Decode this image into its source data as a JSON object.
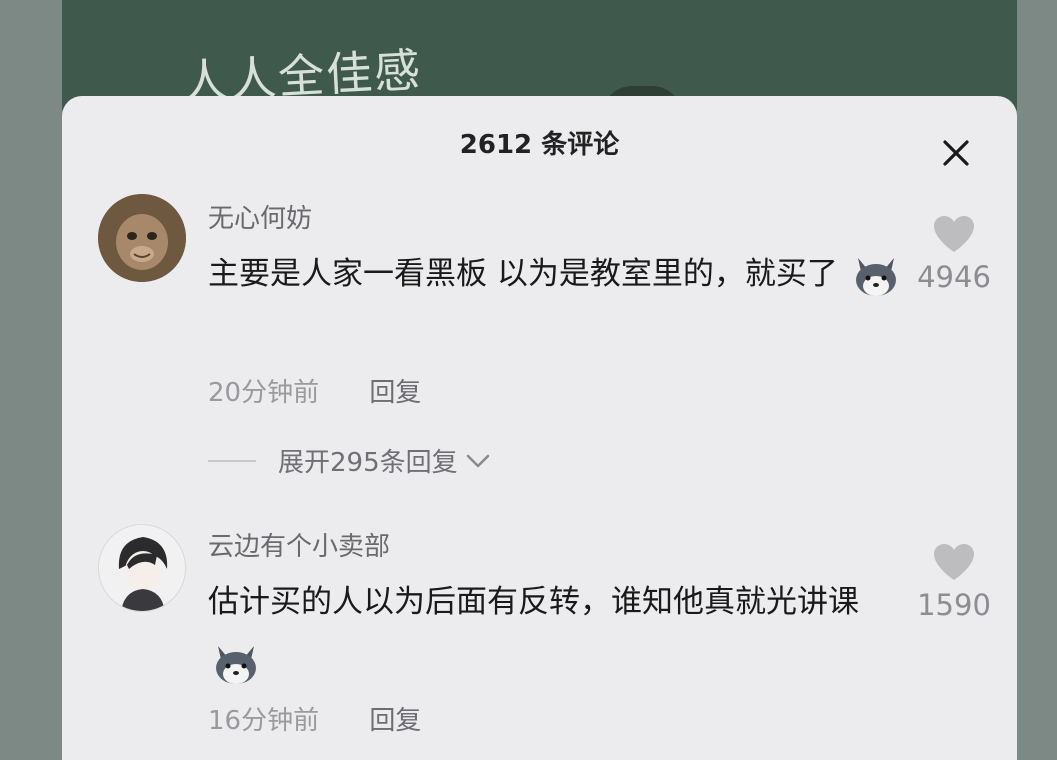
{
  "background_text": "人人全佳感",
  "header": {
    "comment_count_label": "2612 条评论"
  },
  "comments": [
    {
      "username": "无心何妨",
      "text": "主要是人家一看黑板 以为是教室里的，就买了",
      "time": "20分钟前",
      "reply_label": "回复",
      "likes": "4946",
      "expand_replies_label": "展开295条回复"
    },
    {
      "username": "云边有个小卖部",
      "text": "估计买的人以为后面有反转，谁知他真就光讲课",
      "time": "16分钟前",
      "reply_label": "回复",
      "likes": "1590"
    }
  ],
  "colors": {
    "panel_bg": "#ececee",
    "chalkboard_bg": "#3f5a4c",
    "text_primary": "#1a1a1a",
    "text_secondary": "#6a6a6e",
    "like_gray": "#bdbdc0"
  },
  "icons": {
    "close": "close-icon",
    "like": "heart-icon",
    "expand": "chevron-down-icon",
    "emoji": "dog-emoji-icon"
  }
}
